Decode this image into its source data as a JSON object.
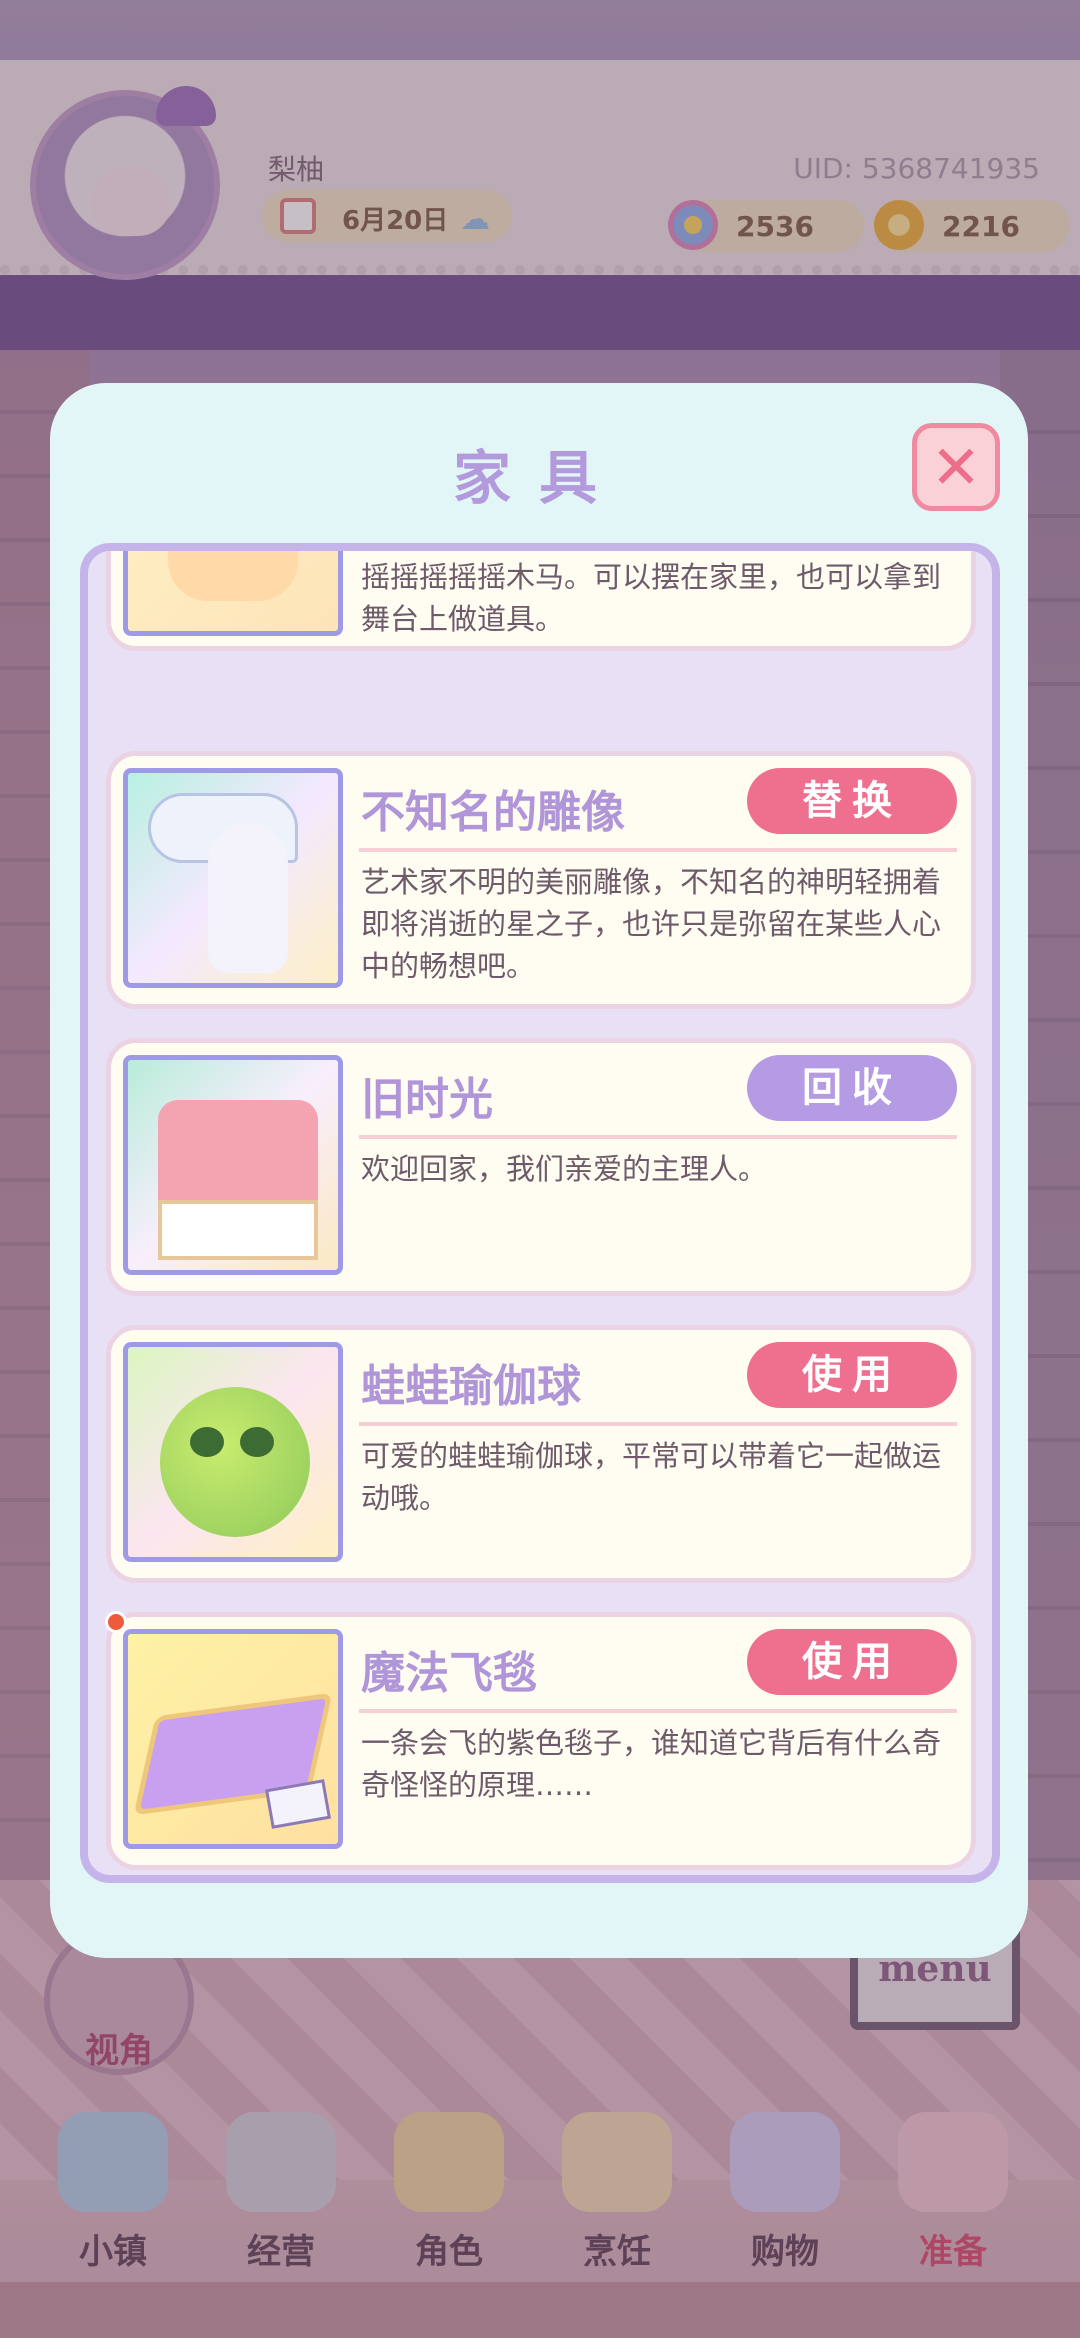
{
  "topbar": {
    "player_name": "梨柚",
    "date": "6月20日",
    "uid": "UID: 5368741935",
    "flowers": "2536",
    "gold": "2216"
  },
  "modal": {
    "title": "家具",
    "close_icon": "close-x-icon"
  },
  "furniture": [
    {
      "name": "",
      "desc": "摇摇摇摇摇木马。可以摆在家里，也可以拿到舞台上做道具。",
      "action": ""
    },
    {
      "name": "不知名的雕像",
      "desc": "艺术家不明的美丽雕像，不知名的神明轻拥着即将消逝的星之子，也许只是弥留在某些人心中的畅想吧。",
      "action": "替换"
    },
    {
      "name": "旧时光",
      "desc": "欢迎回家，我们亲爱的主理人。",
      "action": "回收"
    },
    {
      "name": "蛙蛙瑜伽球",
      "desc": "可爱的蛙蛙瑜伽球，平常可以带着它一起做运动哦。",
      "action": "使用"
    },
    {
      "name": "魔法飞毯",
      "desc": "一条会飞的紫色毯子，谁知道它背后有什么奇奇怪怪的原理……",
      "action": "使用"
    }
  ],
  "scene": {
    "camera_label": "视角",
    "menu_sign": "menu"
  },
  "nav": [
    {
      "label": "小镇",
      "icon": "map-icon"
    },
    {
      "label": "经营",
      "icon": "lock-icon"
    },
    {
      "label": "角色",
      "icon": "character-icon"
    },
    {
      "label": "烹饪",
      "icon": "sandwich-icon"
    },
    {
      "label": "购物",
      "icon": "shopping-bag-icon"
    },
    {
      "label": "准备",
      "icon": "wardrobe-icon"
    }
  ],
  "colors": {
    "accent_pink": "#ee6f8e",
    "accent_purple": "#b49be3",
    "modal_bg": "#e2f6f7",
    "card_bg": "#fffdf1",
    "title_purple": "#b095d9"
  }
}
